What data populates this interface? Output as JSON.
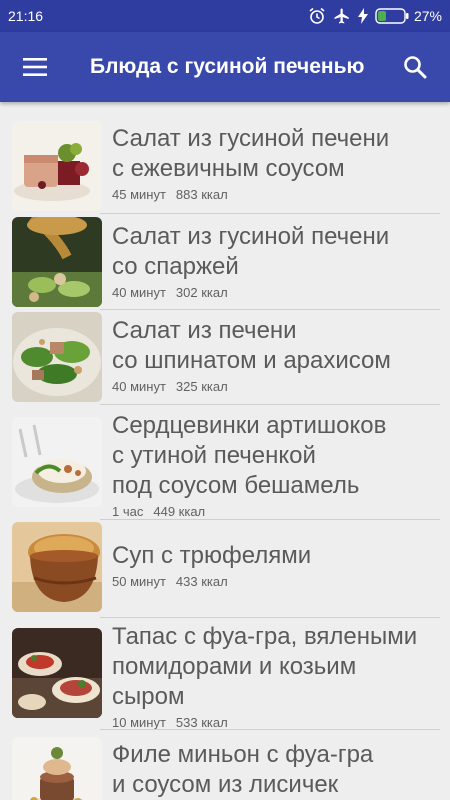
{
  "status_bar": {
    "time": "21:16",
    "battery": "27%"
  },
  "app_bar": {
    "title": "Блюда с гусиной печенью"
  },
  "recipes": [
    {
      "lines": [
        "Салат из гусиной печени",
        "с ежевичным соусом"
      ],
      "time": "45 минут",
      "calories": "883 ккал"
    },
    {
      "lines": [
        "Салат из гусиной печени",
        "со спаржей"
      ],
      "time": "40 минут",
      "calories": "302 ккал"
    },
    {
      "lines": [
        "Салат из печени",
        "со шпинатом и арахисом"
      ],
      "time": "40 минут",
      "calories": "325 ккал"
    },
    {
      "lines": [
        "Сердцевинки артишоков",
        "с утиной печенкой",
        "под соусом бешамель"
      ],
      "time": "1 час",
      "calories": "449 ккал"
    },
    {
      "lines": [
        "Суп с трюфелями"
      ],
      "time": "50 минут",
      "calories": "433 ккал"
    },
    {
      "lines": [
        "Тапас с фуа-гра, вялеными",
        "помидорами и козьим",
        "сыром"
      ],
      "time": "10 минут",
      "calories": "533 ккал"
    },
    {
      "lines": [
        "Филе миньон с фуа-гра",
        "и соусом из лисичек"
      ],
      "time": "",
      "calories": ""
    }
  ]
}
